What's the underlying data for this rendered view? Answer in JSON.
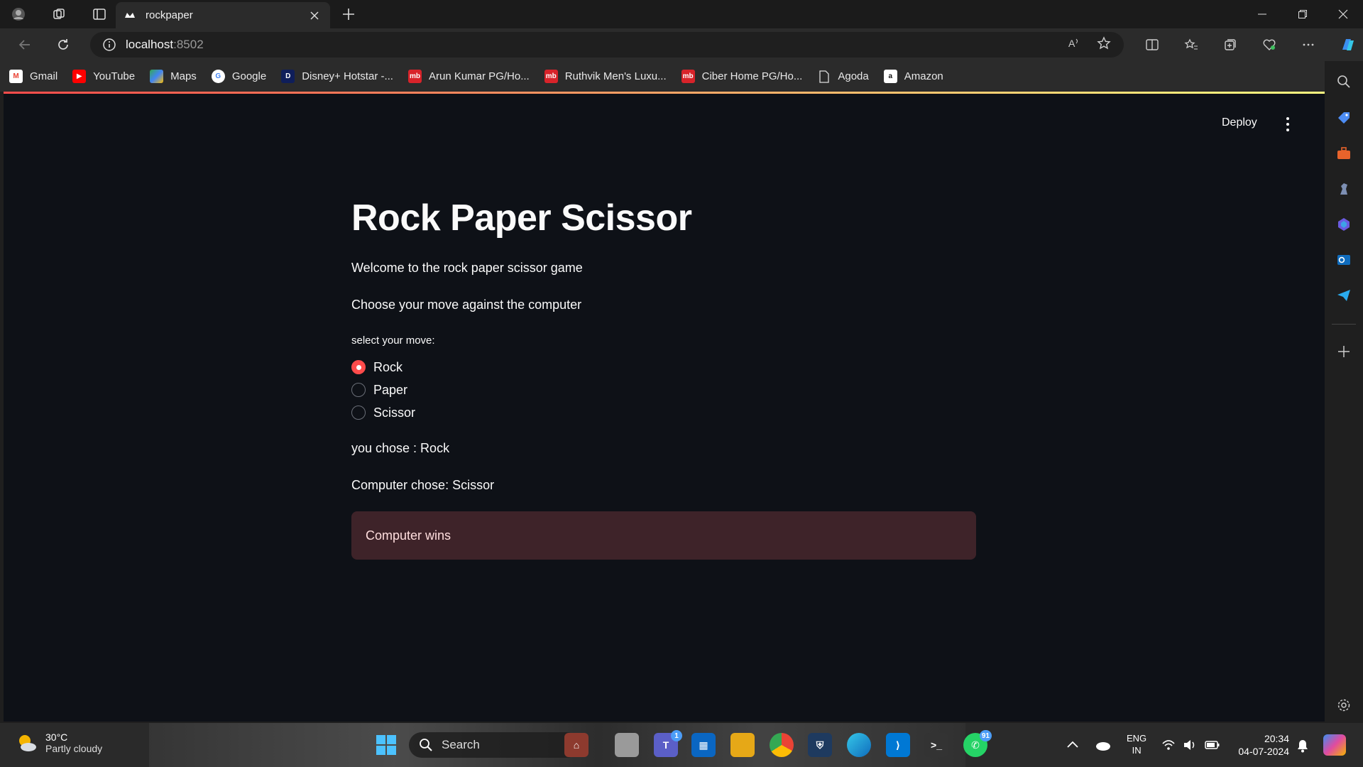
{
  "browser": {
    "tab_title": "rockpaper",
    "url_host": "localhost",
    "url_port": ":8502"
  },
  "bookmarks": [
    {
      "label": "Gmail",
      "icon": "gmail-icon",
      "color": "#ea4335"
    },
    {
      "label": "YouTube",
      "icon": "youtube-icon",
      "color": "#ff0000"
    },
    {
      "label": "Maps",
      "icon": "maps-icon",
      "color": "#34a853"
    },
    {
      "label": "Google",
      "icon": "google-icon",
      "color": "#4285f4"
    },
    {
      "label": "Disney+ Hotstar -...",
      "icon": "hotstar-icon",
      "color": "#0f1e5a"
    },
    {
      "label": "Arun Kumar PG/Ho...",
      "icon": "mb-icon",
      "color": "#d8232a"
    },
    {
      "label": "Ruthvik Men's Luxu...",
      "icon": "mb-icon",
      "color": "#d8232a"
    },
    {
      "label": "Ciber Home PG/Ho...",
      "icon": "mb-icon",
      "color": "#d8232a"
    },
    {
      "label": "Agoda",
      "icon": "page-icon",
      "color": "#555555"
    },
    {
      "label": "Amazon",
      "icon": "amazon-icon",
      "color": "#ffffff"
    }
  ],
  "app": {
    "deploy_label": "Deploy",
    "title": "Rock Paper Scissor",
    "welcome": "Welcome to the rock paper scissor game",
    "instruction": "Choose your move against the computer",
    "radio_label": "select your move:",
    "options": [
      "Rock",
      "Paper",
      "Scissor"
    ],
    "selected_option": "Rock",
    "user_choice": "you chose : Rock",
    "computer_choice": "Computer chose: Scissor",
    "result": "Computer wins",
    "accent_color": "#ff4b4b"
  },
  "taskbar": {
    "temperature": "30°C",
    "weather": "Partly cloudy",
    "search_label": "Search",
    "teams_badge": "1",
    "whatsapp_badge": "91",
    "lang_line1": "ENG",
    "lang_line2": "IN",
    "time": "20:34",
    "date": "04-07-2024"
  }
}
